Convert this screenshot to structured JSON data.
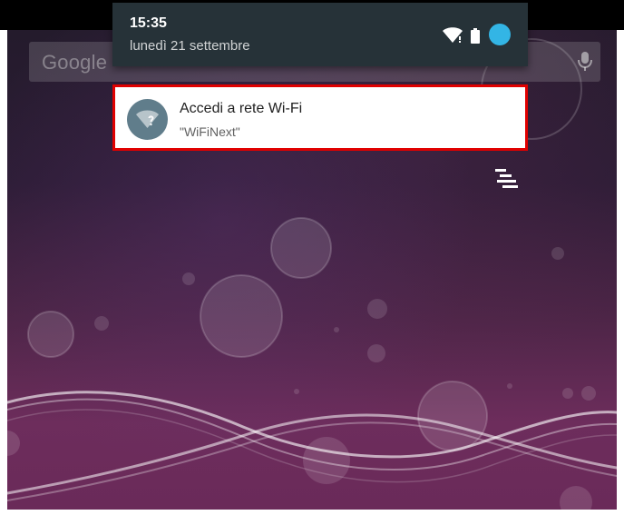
{
  "status_bar": {
    "time": "15:35",
    "date": "lunedì 21 settembre",
    "icons": [
      "wifi-icon",
      "battery-icon",
      "avatar-icon"
    ]
  },
  "search_bar": {
    "label": "Google",
    "icon": "mic-icon"
  },
  "notification": {
    "title": "Accedi a rete Wi-Fi",
    "text": "\"WiFiNext\"",
    "icon": "wifi-question-icon"
  },
  "overlay": {
    "icon": "notification-stack-icon"
  },
  "colors": {
    "shade_background": "#263238",
    "notification_background": "#ffffff",
    "highlight_border": "#e00000",
    "notification_icon": "#607d8b",
    "avatar": "#33b5e5",
    "wallpaper_top": "#241b2c",
    "wallpaper_bottom": "#6d2d5c"
  }
}
